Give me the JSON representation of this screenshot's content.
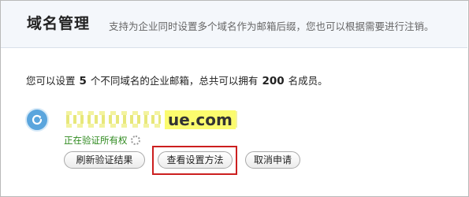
{
  "header": {
    "title": "域名管理",
    "subtitle": "支持为企业同时设置多个域名作为邮箱后缀，您也可以根据需要进行注销。"
  },
  "summary": {
    "prefix": "您可以设置",
    "domain_count": "5",
    "middle": "个不同域名的企业邮箱，总共可以拥有",
    "member_count": "200",
    "suffix": "名成员。"
  },
  "domain": {
    "name_visible": "ue.com",
    "status": "正在验证所有权"
  },
  "buttons": {
    "refresh": "刷新验证结果",
    "view_setup": "查看设置方法",
    "cancel": "取消申请"
  },
  "icons": {
    "domain_icon": "refresh-icon",
    "spinner": "loading-spinner-icon"
  },
  "colors": {
    "header_bg": "#f4f7fb",
    "status_text": "#2f8a1f",
    "highlight_box": "#cc1f1f",
    "icon_blue": "#5aa5dd"
  }
}
